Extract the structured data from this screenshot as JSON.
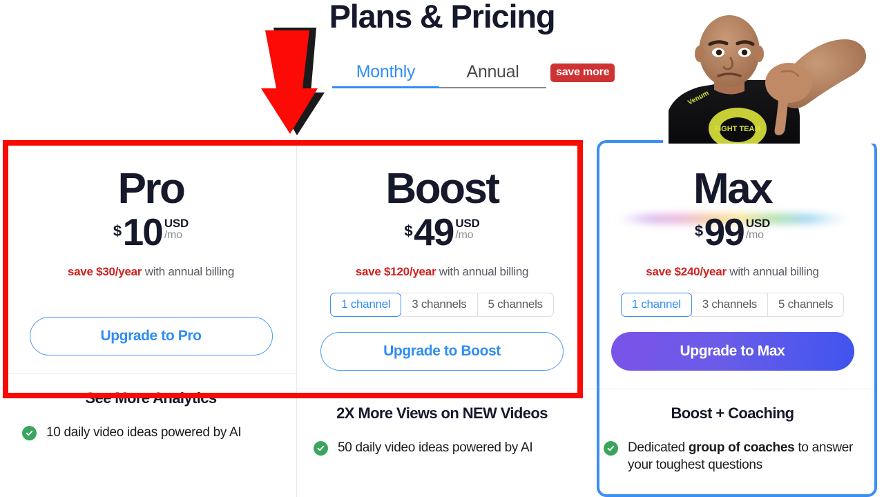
{
  "header": {
    "title": "Plans & Pricing",
    "billing_tabs": [
      {
        "label": "Monthly",
        "active": true
      },
      {
        "label": "Annual",
        "active": false
      }
    ],
    "save_more_badge": "save more"
  },
  "accent_colors": {
    "primary_blue": "#2f8df5",
    "badge_red": "#cf3232",
    "savings_red": "#cf2222",
    "check_green": "#3aa55d",
    "highlight_red": "#f90b05",
    "max_gradient_start": "#7b53e8",
    "max_gradient_end": "#3f54ef"
  },
  "plans": [
    {
      "name": "Pro",
      "currency_symbol": "$",
      "price": "10",
      "currency_code": "USD",
      "period": "/mo",
      "savings_amount": "save $30/year",
      "savings_suffix": " with annual billing",
      "has_channel_selector": false,
      "channel_options": [],
      "cta_label": "Upgrade to Pro",
      "cta_style": "outline",
      "feature_heading": "See More Analytics",
      "features": [
        {
          "text_before": "10 daily video ideas powered by AI",
          "bold": "",
          "text_after": ""
        }
      ]
    },
    {
      "name": "Boost",
      "currency_symbol": "$",
      "price": "49",
      "currency_code": "USD",
      "period": "/mo",
      "savings_amount": "save $120/year",
      "savings_suffix": " with annual billing",
      "has_channel_selector": true,
      "channel_options": [
        {
          "label": "1 channel",
          "selected": true
        },
        {
          "label": "3 channels",
          "selected": false
        },
        {
          "label": "5 channels",
          "selected": false
        }
      ],
      "cta_label": "Upgrade to Boost",
      "cta_style": "outline",
      "feature_heading": "2X More Views on NEW Videos",
      "features": [
        {
          "text_before": "50 daily video ideas powered by AI",
          "bold": "",
          "text_after": ""
        }
      ]
    },
    {
      "name": "Max",
      "currency_symbol": "$",
      "price": "99",
      "currency_code": "USD",
      "period": "/mo",
      "savings_amount": "save $240/year",
      "savings_suffix": " with annual billing",
      "has_channel_selector": true,
      "channel_options": [
        {
          "label": "1 channel",
          "selected": true
        },
        {
          "label": "3 channels",
          "selected": false
        },
        {
          "label": "5 channels",
          "selected": false
        }
      ],
      "cta_label": "Upgrade to Max",
      "cta_style": "filled",
      "feature_heading": "Boost + Coaching",
      "features": [
        {
          "text_before": "Dedicated ",
          "bold": "group of coaches",
          "text_after": " to answer your toughest questions"
        }
      ]
    }
  ],
  "annotations": {
    "arrow": "red-down-arrow",
    "highlight_box": "red-rectangle-highlight",
    "max_outline": "blue-rounded-outline",
    "presenter": "video-presenter-overlay"
  }
}
